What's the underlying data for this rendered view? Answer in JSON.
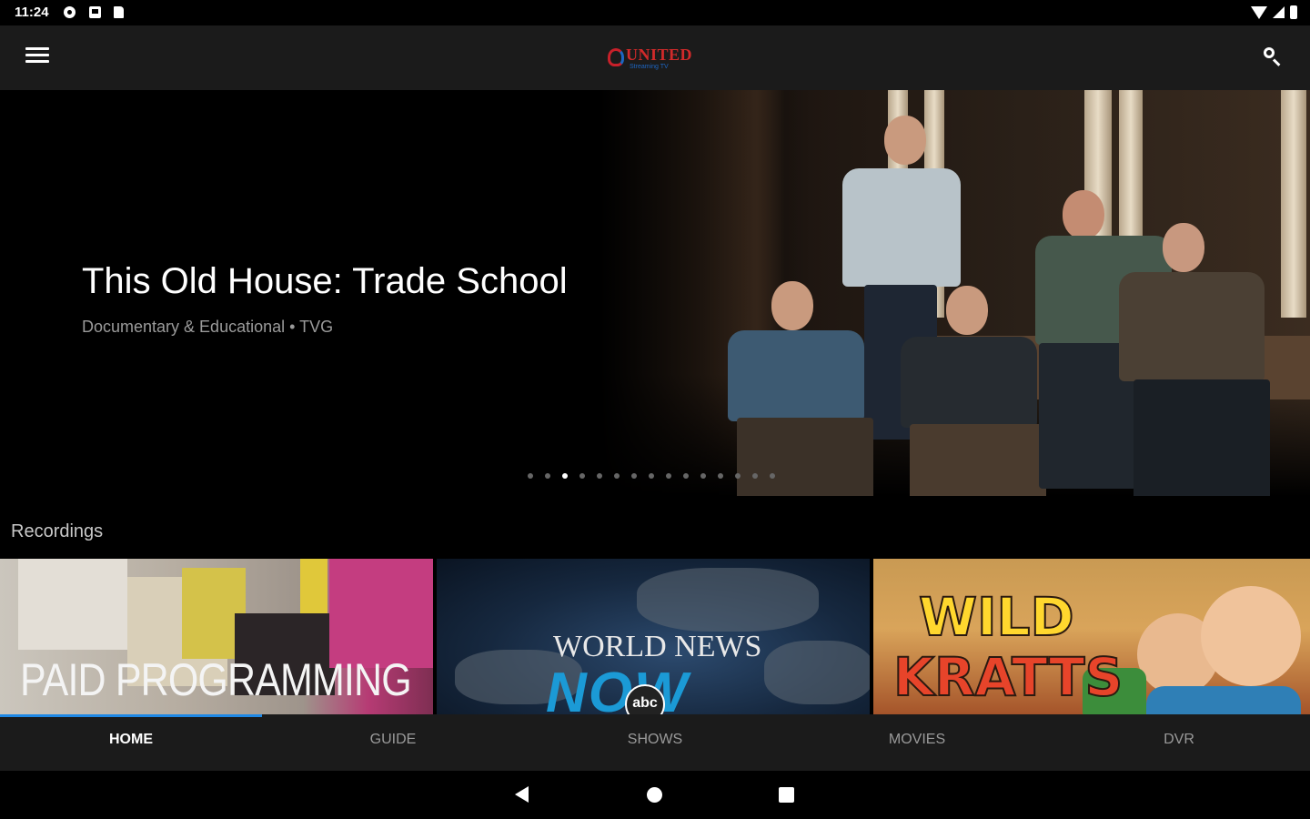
{
  "status_bar": {
    "time": "11:24"
  },
  "app_bar": {
    "logo_text": "UNITED",
    "logo_tagline": "Streaming TV"
  },
  "hero": {
    "title": "This Old House: Trade School",
    "subtitle": "Documentary & Educational • TVG",
    "carousel_count": 15,
    "carousel_active_index": 2
  },
  "recordings": {
    "label": "Recordings",
    "items": [
      {
        "title": "PAID PROGRAMMING"
      },
      {
        "title": "WORLD NEWS",
        "title_line2": "NOW",
        "badge": "abc"
      },
      {
        "title_line1": "WILD",
        "title_line2": "KRATTS"
      }
    ]
  },
  "bottom_nav": {
    "items": [
      {
        "label": "HOME",
        "active": true
      },
      {
        "label": "GUIDE",
        "active": false
      },
      {
        "label": "SHOWS",
        "active": false
      },
      {
        "label": "MOVIES",
        "active": false
      },
      {
        "label": "DVR",
        "active": false
      }
    ]
  },
  "icons": {
    "menu": "hamburger-menu-icon",
    "search": "search-icon",
    "back": "back-triangle-icon",
    "home": "home-circle-icon",
    "recents": "recents-square-icon"
  },
  "colors": {
    "accent": "#1e88e5",
    "appbar": "#1b1b1b",
    "logo_red": "#d12a2a",
    "logo_blue": "#1e66c2"
  }
}
